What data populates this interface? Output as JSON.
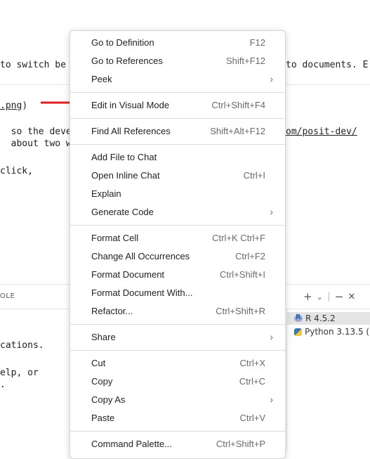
{
  "editor": {
    "line1_left": "to switch be",
    "line1_right": "to documents. E",
    "line2": ".png",
    "line2_close": ")",
    "line3_left": "  so the deve",
    "line3_right": "om/posit-dev/",
    "line4_left": "  about two w",
    "line5": "click,"
  },
  "panel": {
    "title": "OLE",
    "output_line1": "cations.",
    "output_line2": "elp, or",
    "output_line3": ".",
    "actions": {
      "add": "+",
      "dropdown": "⌄",
      "minimize": "−",
      "close": "✕"
    },
    "terminals": [
      {
        "label": "R 4.5.2",
        "icon": "r-icon"
      },
      {
        "label": "Python 3.13.5 (",
        "icon": "python-icon"
      }
    ]
  },
  "menu": {
    "groups": [
      [
        {
          "label": "Go to Definition",
          "shortcut": "F12"
        },
        {
          "label": "Go to References",
          "shortcut": "Shift+F12"
        },
        {
          "label": "Peek",
          "submenu": true
        }
      ],
      [
        {
          "label": "Edit in Visual Mode",
          "shortcut": "Ctrl+Shift+F4"
        }
      ],
      [
        {
          "label": "Find All References",
          "shortcut": "Shift+Alt+F12"
        }
      ],
      [
        {
          "label": "Add File to Chat"
        },
        {
          "label": "Open Inline Chat",
          "shortcut": "Ctrl+I"
        },
        {
          "label": "Explain"
        },
        {
          "label": "Generate Code",
          "submenu": true
        }
      ],
      [
        {
          "label": "Format Cell",
          "shortcut": "Ctrl+K Ctrl+F"
        },
        {
          "label": "Change All Occurrences",
          "shortcut": "Ctrl+F2"
        },
        {
          "label": "Format Document",
          "shortcut": "Ctrl+Shift+I"
        },
        {
          "label": "Format Document With..."
        },
        {
          "label": "Refactor...",
          "shortcut": "Ctrl+Shift+R"
        }
      ],
      [
        {
          "label": "Share",
          "submenu": true
        }
      ],
      [
        {
          "label": "Cut",
          "shortcut": "Ctrl+X"
        },
        {
          "label": "Copy",
          "shortcut": "Ctrl+C"
        },
        {
          "label": "Copy As",
          "submenu": true
        },
        {
          "label": "Paste",
          "shortcut": "Ctrl+V"
        }
      ],
      [
        {
          "label": "Command Palette...",
          "shortcut": "Ctrl+Shift+P"
        }
      ]
    ],
    "submenu_glyph": "›"
  },
  "colors": {
    "arrow": "#e02020",
    "menu_bg": "#ffffff",
    "shortcut": "#6a6a6a"
  }
}
